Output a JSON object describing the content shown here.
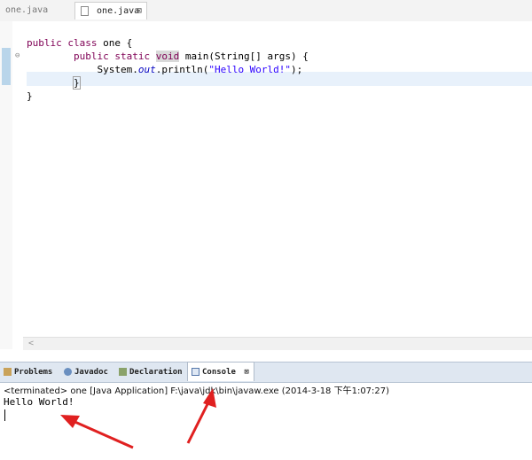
{
  "editor_tabs": [
    {
      "label": "one.java",
      "active": false
    },
    {
      "label": "one.java",
      "active": true,
      "close": "⊠"
    }
  ],
  "code": {
    "line1": {
      "kw": "public class",
      "rest": " one {"
    },
    "line2": {
      "kw": "public static",
      "void": "void",
      "rest": " main(String[] args) {"
    },
    "line3": {
      "pre": "System.",
      "field": "out",
      "mid": ".println(",
      "str": "\"Hello World!\"",
      "post": ");"
    },
    "line4": "}",
    "line5": "}"
  },
  "view_tabs": {
    "problems": "Problems",
    "javadoc": "Javadoc",
    "declaration": "Declaration",
    "console": "Console",
    "console_close": "⊠"
  },
  "console": {
    "status": "<terminated> one [Java Application] F:\\java\\jdk\\bin\\javaw.exe (2014-3-18 下午1:07:27)",
    "output": "Hello World!"
  },
  "colors": {
    "keyword": "#7f0055",
    "string": "#2a00ff",
    "field": "#0000c0",
    "annotation_arrow": "#e02020"
  }
}
